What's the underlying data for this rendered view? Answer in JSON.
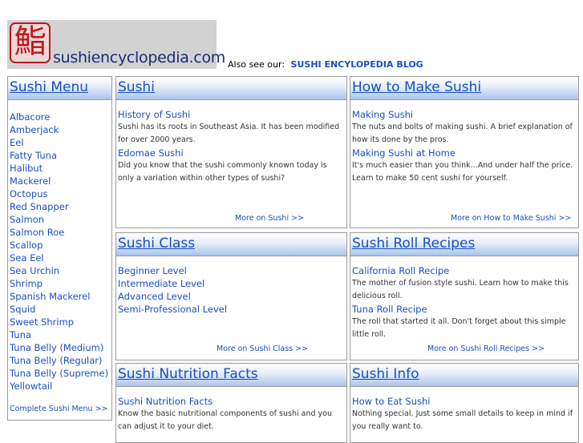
{
  "logo": {
    "kanji": "鮨",
    "text": "sushiencyclopedia.com"
  },
  "also_see": {
    "label": "Also see our:",
    "link": "SUSHI ENCYLOPEDIA BLOG"
  },
  "menu": {
    "title": "Sushi Menu",
    "items": [
      "Albacore",
      "Amberjack",
      "Eel",
      "Fatty Tuna",
      "Halibut",
      "Mackerel",
      "Octopus",
      "Red Snapper",
      "Salmon",
      "Salmon Roe",
      "Scallop",
      "Sea Eel",
      "Sea Urchin",
      "Shrimp",
      "Spanish Mackerel",
      "Squid",
      "Sweet Shrimp",
      "Tuna",
      "Tuna Belly (Medium)",
      "Tuna Belly (Regular)",
      "Tuna Belly (Supreme)",
      "Yellowtail"
    ],
    "more": "Complete Sushi Menu >>"
  },
  "sushi": {
    "title": "Sushi",
    "link1": "History of Sushi",
    "desc1": "Sushi has its roots in Southeast Asia. It has been modified for over 2000 years.",
    "link2": "Edomae Sushi",
    "desc2": "Did you know that the sushi commonly known today is only a variation within  other  types of sushi?",
    "more": "More on Sushi >>"
  },
  "how_to": {
    "title": "How to Make Sushi",
    "link1": "Making Sushi",
    "desc1": "The nuts and bolts of making sushi. A brief explanation of how its done by the pros.",
    "link2": "Making Sushi at Home",
    "desc2": "It's much easier than you think...And under half the price. Learn to make 50 cent sushi for yourself.",
    "more": "More on How to Make Sushi >>"
  },
  "sushi_class": {
    "title": "Sushi Class",
    "links": [
      "Beginner Level",
      "Intermediate Level",
      "Advanced Level",
      "Semi-Professional Level"
    ],
    "more": "More on Sushi Class >>"
  },
  "roll_recipes": {
    "title": "Sushi Roll Recipes",
    "link1": "California Roll Recipe",
    "desc1": "The mother of fusion style sushi. Learn how to make this delicious roll.",
    "link2": "Tuna Roll Recipe",
    "desc2": "The roll that started it all. Don't forget about this simple little roll.",
    "more": "More on Sushi Roll Recipes >>"
  },
  "nutrition": {
    "title": "Sushi Nutrition Facts",
    "link1": "Sushi Nutrition Facts",
    "desc1": "Know the basic nutritional components of sushi and you can adjust it to your diet."
  },
  "info": {
    "title": "Sushi Info",
    "link1": "How to Eat Sushi",
    "desc1": "Nothing special. Just some small details to keep in mind if you really want to."
  }
}
